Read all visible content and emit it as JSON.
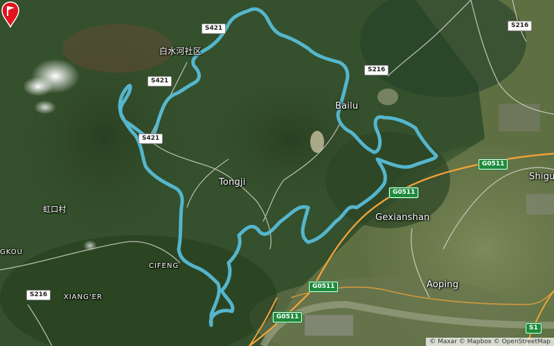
{
  "places": {
    "baishuihe": "白水河社区",
    "bailu": "Bailu",
    "tongji": "Tongji",
    "hongkou": "虹口村",
    "gkou": "GKOU",
    "cifeng": "CIFENG",
    "xiang_er": "XIANG'ER",
    "gexianshan": "Gexianshan",
    "aoping": "Aoping",
    "shigu": "Shigu"
  },
  "shields": {
    "s421_a": "S421",
    "s421_b": "S421",
    "s421_c": "S421",
    "s216_a": "S216",
    "s216_b": "S216",
    "s216_c": "S216",
    "g0511_a": "G0511",
    "g0511_b": "G0511",
    "g0511_c": "G0511",
    "g0511_d": "G0511",
    "s1": "S1"
  },
  "attribution": "© Maxar © Mapbox © OpenStreetMap",
  "colors": {
    "route": "#57bcd6",
    "expressway": "#f0a23a",
    "marker": "#e0141e"
  }
}
